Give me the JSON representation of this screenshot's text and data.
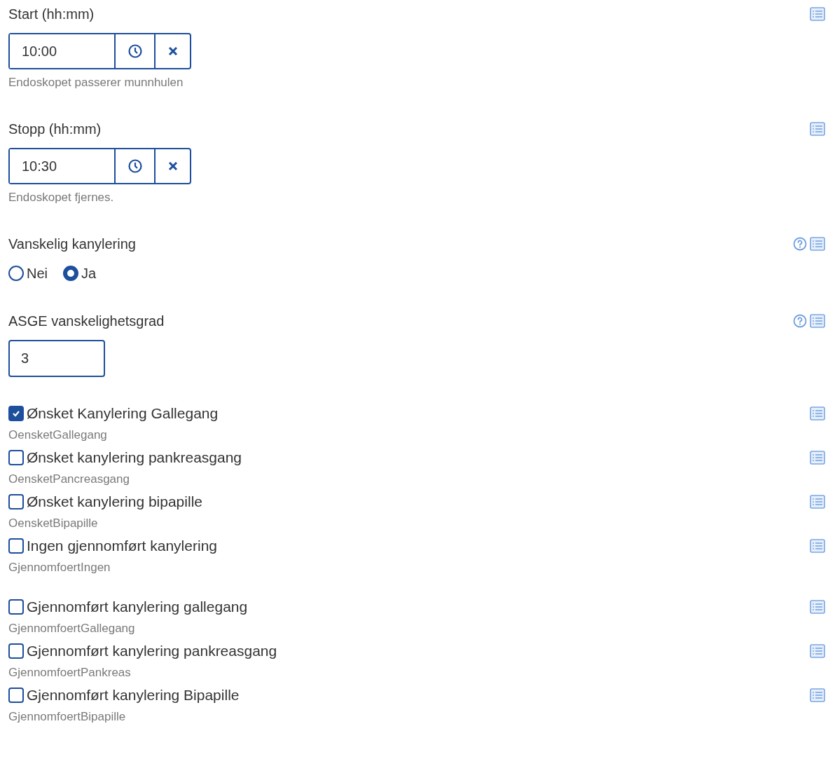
{
  "fields": [
    {
      "kind": "time",
      "label": "Start (hh:mm)",
      "value": "10:00",
      "hint": "Endoskopet passerer munnhulen",
      "help": false
    },
    {
      "kind": "time",
      "label": "Stopp (hh:mm)",
      "value": "10:30",
      "hint": "Endoskopet fjernes.",
      "help": false
    },
    {
      "kind": "radio",
      "label": "Vanskelig kanylering",
      "help": true,
      "options": [
        {
          "label": "Nei",
          "selected": false
        },
        {
          "label": "Ja",
          "selected": true
        }
      ]
    },
    {
      "kind": "number",
      "label": "ASGE vanskelighetsgrad",
      "value": "3",
      "help": true
    },
    {
      "kind": "checkbox_group",
      "items": [
        {
          "label": "Ønsket Kanylering Gallegang",
          "hint": "OensketGallegang",
          "checked": true
        },
        {
          "label": "Ønsket kanylering pankreasgang",
          "hint": "OensketPancreasgang",
          "checked": false
        },
        {
          "label": "Ønsket kanylering bipapille",
          "hint": "OensketBipapille",
          "checked": false
        },
        {
          "label": "Ingen gjennomført kanylering",
          "hint": "GjennomfoertIngen",
          "checked": false
        }
      ]
    },
    {
      "kind": "checkbox_group",
      "items": [
        {
          "label": "Gjennomført kanylering gallegang",
          "hint": "GjennomfoertGallegang",
          "checked": false
        },
        {
          "label": "Gjennomført kanylering pankreasgang",
          "hint": "GjennomfoertPankreas",
          "checked": false
        },
        {
          "label": "Gjennomført kanylering Bipapille",
          "hint": "GjennomfoertBipapille",
          "checked": false
        }
      ]
    }
  ]
}
